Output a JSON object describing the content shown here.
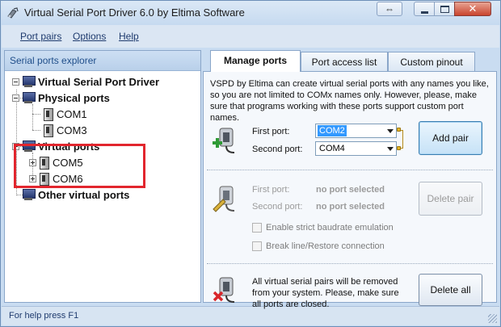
{
  "window": {
    "title": "Virtual Serial Port Driver 6.0 by Eltima Software"
  },
  "menu": {
    "items": [
      "Port pairs",
      "Options",
      "Help"
    ]
  },
  "explorer": {
    "header": "Serial ports explorer",
    "root": "Virtual Serial Port Driver",
    "physical_group": "Physical ports",
    "physical_ports": [
      "COM1",
      "COM3"
    ],
    "virtual_group": "Virtual ports",
    "virtual_ports": [
      "COM5",
      "COM6"
    ],
    "other_group": "Other virtual ports"
  },
  "tabs": [
    "Manage ports",
    "Port access list",
    "Custom pinout"
  ],
  "manage": {
    "description": "VSPD by Eltima can create virtual serial ports with any names you like, so you are not limited to COMx names only. However, please, make sure that programs working with these ports support custom port names.",
    "add": {
      "first_port_label": "First port:",
      "first_port_value": "COM2",
      "second_port_label": "Second port:",
      "second_port_value": "COM4",
      "button": "Add pair"
    },
    "delete": {
      "first_port_label": "First port:",
      "first_port_value": "no port selected",
      "second_port_label": "Second port:",
      "second_port_value": "no port selected",
      "button": "Delete pair",
      "checkbox_baudrate": "Enable strict baudrate emulation",
      "checkbox_break": "Break line/Restore connection"
    },
    "delete_all": {
      "text": "All virtual serial pairs will be removed from your system. Please, make sure all ports are closed.",
      "button": "Delete all"
    }
  },
  "status": {
    "text": "For help press F1"
  }
}
